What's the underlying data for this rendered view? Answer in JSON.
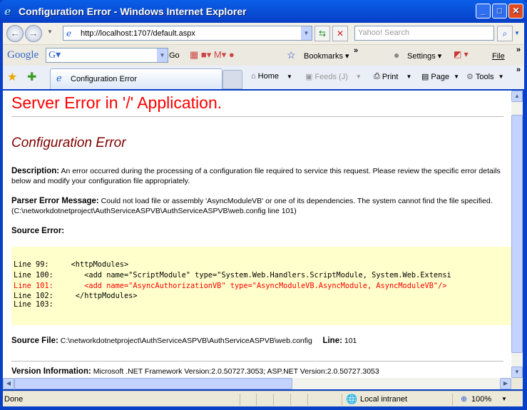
{
  "window": {
    "title": "Configuration Error - Windows Internet Explorer"
  },
  "address": {
    "url": "http://localhost:1707/default.aspx",
    "search_placeholder": "Yahoo! Search"
  },
  "google_toolbar": {
    "logo": "Google",
    "go": "Go",
    "bookmarks": "Bookmarks",
    "settings": "Settings",
    "file": "File"
  },
  "tabs": [
    {
      "label": "Configuration Error"
    }
  ],
  "command_bar": {
    "home": "Home",
    "feeds": "Feeds (J)",
    "print": "Print",
    "page": "Page",
    "tools": "Tools"
  },
  "page": {
    "heading": "Server Error in '/' Application.",
    "subheading": "Configuration Error",
    "description_label": "Description:",
    "description": "An error occurred during the processing of a configuration file required to service this request. Please review the specific error details below and modify your configuration file appropriately.",
    "parser_label": "Parser Error Message:",
    "parser": "Could not load file or assembly 'AsyncModuleVB' or one of its dependencies. The system cannot find the file specified. (C:\\networkdotnetproject\\AuthServiceASPVB\\AuthServiceASPVB\\web.config line 101)",
    "source_error_label": "Source Error:",
    "code_lines": [
      {
        "num": "Line 99:",
        "text": "     <httpModules>"
      },
      {
        "num": "Line 100:",
        "text": "       <add name=\"ScriptModule\" type=\"System.Web.Handlers.ScriptModule, System.Web.Extensi"
      },
      {
        "num": "Line 101:",
        "text": "       <add name=\"AsyncAuthorizationVB\" type=\"AsyncModuleVB.AsyncModule, AsyncModuleVB\"/>"
      },
      {
        "num": "Line 102:",
        "text": "     </httpModules>"
      },
      {
        "num": "Line 103:",
        "text": ""
      }
    ],
    "source_file_label": "Source File:",
    "source_file": "C:\\networkdotnetproject\\AuthServiceASPVB\\AuthServiceASPVB\\web.config",
    "line_label": "Line:",
    "line": "101",
    "version_label": "Version Information:",
    "version": "Microsoft .NET Framework Version:2.0.50727.3053; ASP.NET Version:2.0.50727.3053"
  },
  "status": {
    "text": "Done",
    "zone": "Local intranet",
    "zoom": "100%"
  }
}
